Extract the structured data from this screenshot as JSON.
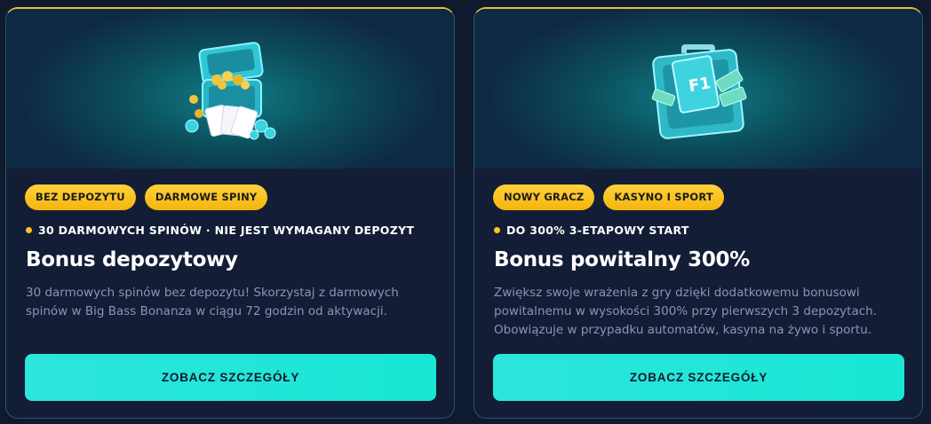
{
  "cards": [
    {
      "tags": [
        "BEZ DEPOZYTU",
        "DARMOWE SPINY"
      ],
      "meta": "30 DARMOWYCH SPINÓW · NIE JEST WYMAGANY DEPOZYT",
      "title": "Bonus depozytowy",
      "description": "30 darmowych spinów bez depozytu! Skorzystaj z darmowych spinów w Big Bass Bonanza w ciągu 72 godzin od aktywacji.",
      "cta": "ZOBACZ SZCZEGÓŁY",
      "image": "treasure-chest-icon"
    },
    {
      "tags": [
        "NOWY GRACZ",
        "KASYNO I SPORT"
      ],
      "meta": "DO 300% 3-ETAPOWY START",
      "title": "Bonus powitalny 300%",
      "description": "Zwiększ swoje wrażenia z gry dzięki dodatkowemu bonusowi powitalnemu w wysokości 300% przy pierwszych 3 depozytach. Obowiązuje w przypadku automatów, kasyna na żywo i sportu.",
      "cta": "ZOBACZ SZCZEGÓŁY",
      "image": "money-briefcase-icon",
      "image_text": "F1"
    }
  ],
  "colors": {
    "accent_cyan": "#1fe6d6",
    "tag_yellow": "#f8c21a",
    "card_bg": "#141d36",
    "border_gold": "#e7c32c"
  }
}
